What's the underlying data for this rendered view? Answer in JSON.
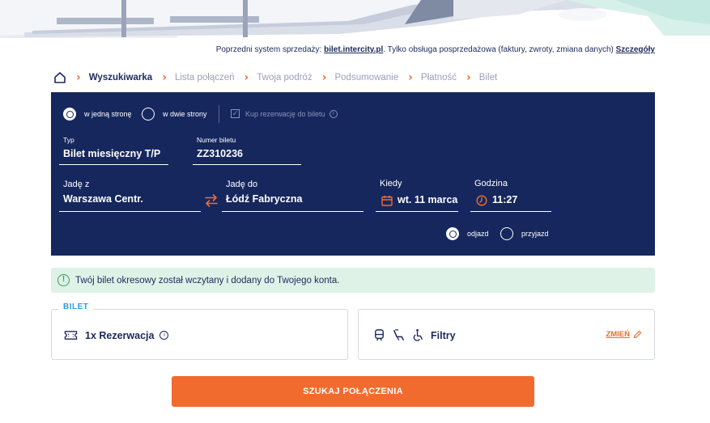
{
  "notice": {
    "prefix": "Poprzedni system sprzedaży:",
    "link": "bilet.intercity.pl",
    "middle": ". Tylko obsługa posprzedażowa (faktury, zwroty, zmiana danych)",
    "details": "Szczegóły"
  },
  "breadcrumb": {
    "steps": [
      "Wyszukiwarka",
      "Lista połączeń",
      "Twoja podróż",
      "Podsumowanie",
      "Płatność",
      "Bilet"
    ],
    "active_index": 0
  },
  "trip_type": {
    "one_way": "w jedną stronę",
    "round_trip": "w dwie strony",
    "selected": "one_way"
  },
  "reservation_checkbox": {
    "label": "Kup rezerwację do biletu",
    "checked": true
  },
  "ticket": {
    "type_label": "Typ",
    "type_value": "Bilet miesięczny T/P",
    "number_label": "Numer biletu",
    "number_value": "ZZ310236"
  },
  "route": {
    "from_label": "Jadę z",
    "from_value": "Warszawa Centr.",
    "to_label": "Jadę do",
    "to_value": "Łódź Fabryczna",
    "date_label": "Kiedy",
    "date_value": "wt. 11 marca",
    "time_label": "Godzina",
    "time_value": "11:27"
  },
  "time_mode": {
    "departure": "odjazd",
    "arrival": "przyjazd",
    "selected": "departure"
  },
  "message": "Twój bilet okresowy został wczytany i dodany do Twojego konta.",
  "ticket_card": {
    "tag": "BILET",
    "title": "1x Rezerwacja"
  },
  "filters_card": {
    "title": "Filtry",
    "edit": "ZMIEŃ"
  },
  "search_button": "SZUKAJ POŁĄCZENIA",
  "colors": {
    "navy": "#16275e",
    "accent": "#f26b2e",
    "success_bg": "#dff2e7",
    "success": "#2f9e5a",
    "tag": "#2c9fd6"
  }
}
